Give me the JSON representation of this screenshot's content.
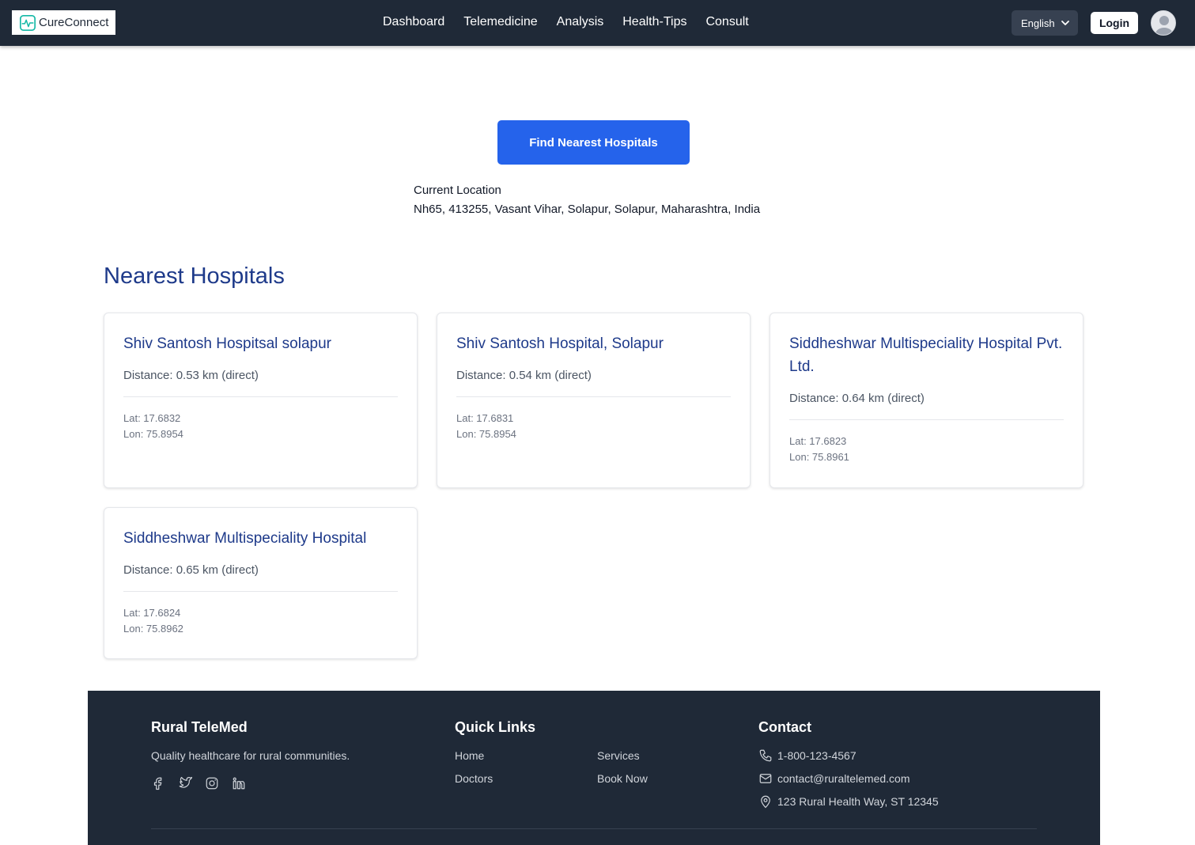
{
  "nav": {
    "brand": "CureConnect",
    "links": [
      "Dashboard",
      "Telemedicine",
      "Analysis",
      "Health-Tips",
      "Consult"
    ],
    "language": "English",
    "login_label": "Login"
  },
  "main": {
    "find_button": "Find Nearest Hospitals",
    "location_label": "Current Location",
    "location_value": "Nh65, 413255, Vasant Vihar, Solapur, Solapur, Maharashtra, India",
    "section_title": "Nearest Hospitals",
    "hospitals": [
      {
        "name": "Shiv Santosh Hospitsal solapur",
        "distance": "Distance: 0.53 km (direct)",
        "lat": "Lat: 17.6832",
        "lon": "Lon: 75.8954"
      },
      {
        "name": "Shiv Santosh Hospital, Solapur",
        "distance": "Distance: 0.54 km (direct)",
        "lat": "Lat: 17.6831",
        "lon": "Lon: 75.8954"
      },
      {
        "name": "Siddheshwar Multispeciality Hospital Pvt. Ltd.",
        "distance": "Distance: 0.64 km (direct)",
        "lat": "Lat: 17.6823",
        "lon": "Lon: 75.8961"
      },
      {
        "name": "Siddheshwar Multispeciality Hospital",
        "distance": "Distance: 0.65 km (direct)",
        "lat": "Lat: 17.6824",
        "lon": "Lon: 75.8962"
      }
    ]
  },
  "footer": {
    "brand_title": "Rural TeleMed",
    "tagline": "Quality healthcare for rural communities.",
    "social_icons": [
      "facebook-icon",
      "twitter-icon",
      "instagram-icon",
      "linkedin-icon"
    ],
    "quick_links_title": "Quick Links",
    "quick_links": [
      "Home",
      "Services",
      "Doctors",
      "Book Now"
    ],
    "contact_title": "Contact",
    "phone": "1-800-123-4567",
    "email": "contact@ruraltelemed.com",
    "address": "123 Rural Health Way, ST 12345"
  },
  "colors": {
    "navbar": "#1f2937",
    "primary_button": "#2563eb",
    "heading": "#1e3a8a"
  }
}
